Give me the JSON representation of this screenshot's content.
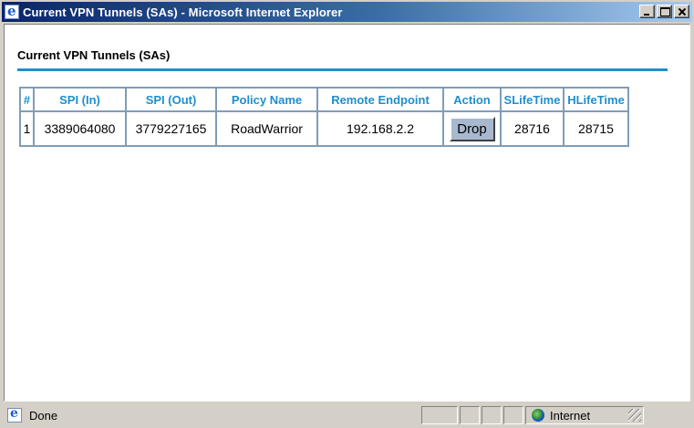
{
  "window": {
    "title": "Current VPN Tunnels (SAs) - Microsoft Internet Explorer"
  },
  "page": {
    "heading": "Current VPN Tunnels (SAs)"
  },
  "table": {
    "headers": [
      "#",
      "SPI (In)",
      "SPI (Out)",
      "Policy Name",
      "Remote Endpoint",
      "Action",
      "SLifeTime",
      "HLifeTime"
    ],
    "rows": [
      {
        "index": "1",
        "spi_in": "3389064080",
        "spi_out": "3779227165",
        "policy_name": "RoadWarrior",
        "remote_endpoint": "192.168.2.2",
        "action_label": "Drop",
        "slifetime": "28716",
        "hlifetime": "28715"
      }
    ]
  },
  "statusbar": {
    "status_text": "Done",
    "zone": "Internet"
  },
  "colors": {
    "accent": "#1d8fce",
    "title_bar_start": "#0a246a",
    "title_bar_end": "#a6caf0",
    "button_face": "#a8b8cf"
  }
}
